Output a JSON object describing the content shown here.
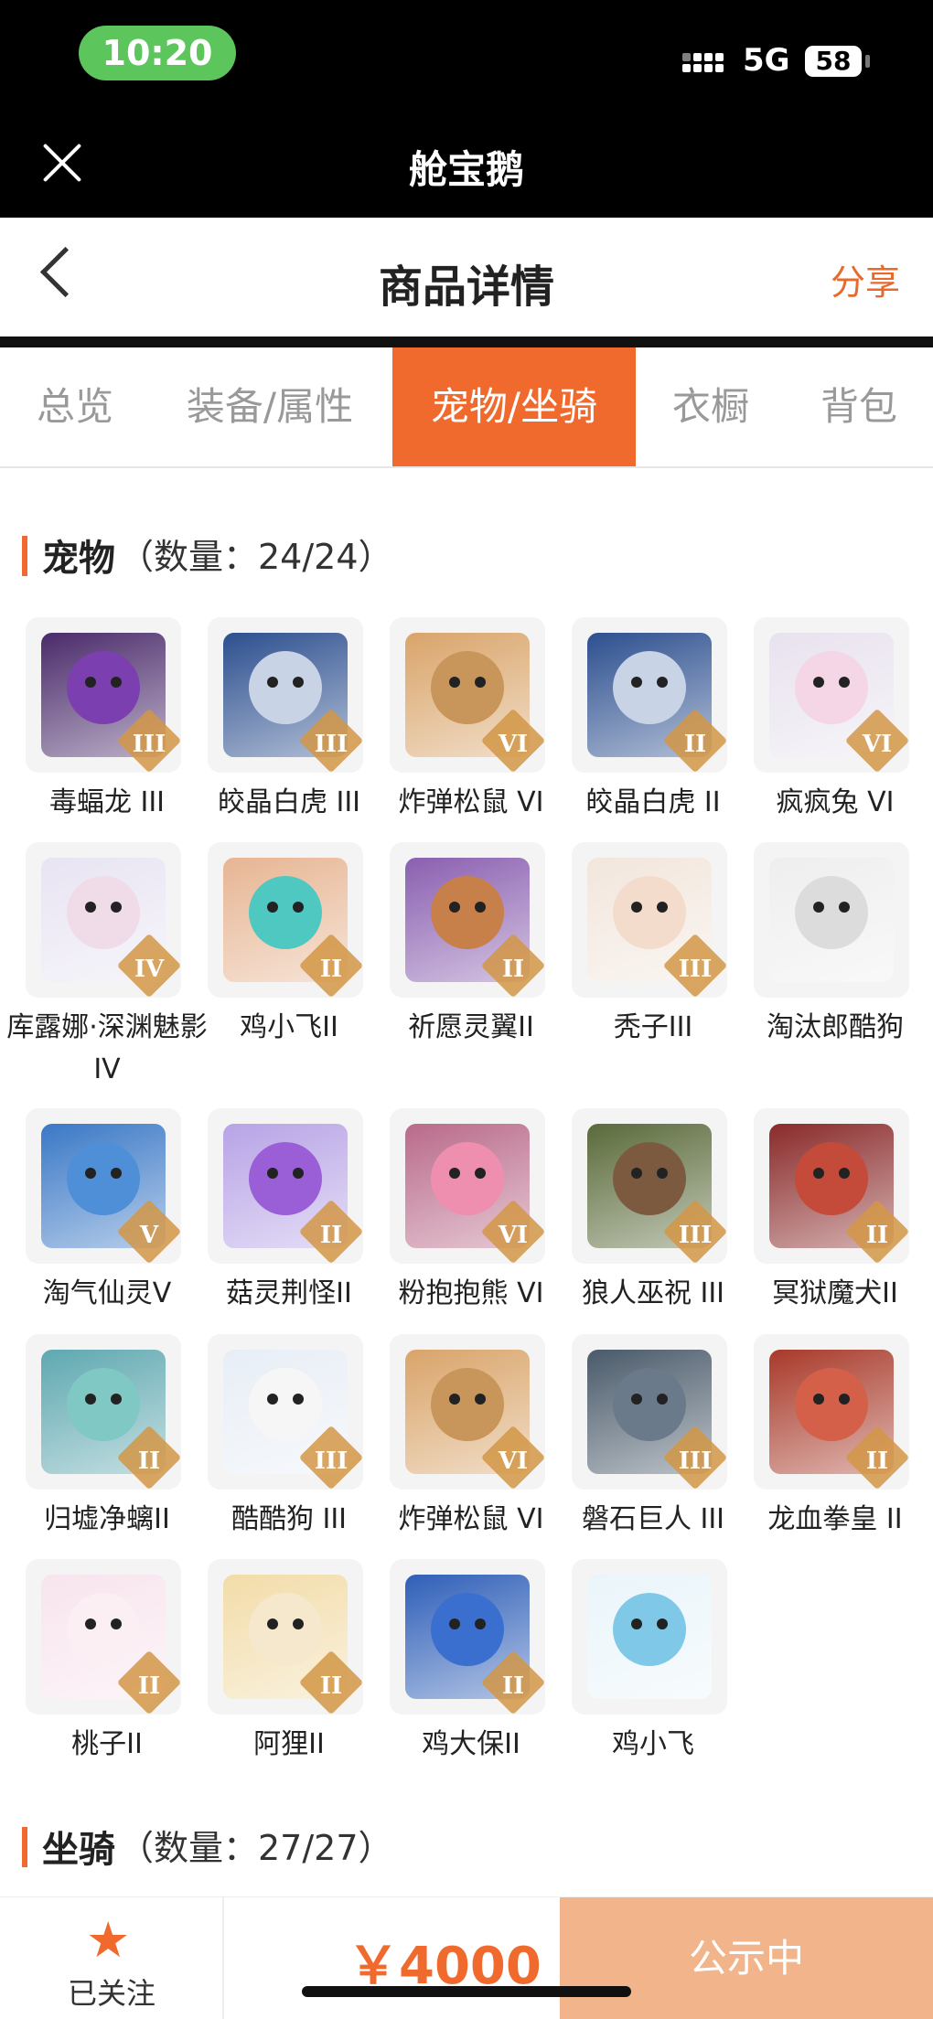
{
  "status_bar": {
    "time": "10:20",
    "network": "5G",
    "battery": "58"
  },
  "app_bar": {
    "title": "舱宝鹅"
  },
  "nav": {
    "title": "商品详情",
    "share": "分享"
  },
  "tabs": [
    {
      "label": "总览",
      "active": false
    },
    {
      "label": "装备/属性",
      "active": false
    },
    {
      "label": "宠物/坐骑",
      "active": true
    },
    {
      "label": "衣橱",
      "active": false
    },
    {
      "label": "背包",
      "active": false
    }
  ],
  "pets_section": {
    "name": "宠物",
    "count": "（数量：24/24）"
  },
  "mounts_section": {
    "name": "坐骑",
    "count": "（数量：27/27）"
  },
  "pets": [
    {
      "name": "毒蝠龙 III",
      "badge": "III",
      "color": "#4a2a6a",
      "head": "#7b3fb0"
    },
    {
      "name": "皎晶白虎 III",
      "badge": "III",
      "color": "#2c4f8f",
      "head": "#c8d4e6"
    },
    {
      "name": "炸弹松鼠 VI",
      "badge": "VI",
      "color": "#d9a46a",
      "head": "#c8955a"
    },
    {
      "name": "皎晶白虎 II",
      "badge": "II",
      "color": "#2c4f8f",
      "head": "#c8d4e6"
    },
    {
      "name": "疯疯兔 VI",
      "badge": "VI",
      "color": "#e8e2ee",
      "head": "#f4d6e6"
    },
    {
      "name": "库露娜·深渊魅影IV",
      "badge": "IV",
      "color": "#e8e4f2",
      "head": "#f0dce8"
    },
    {
      "name": "鸡小飞II",
      "badge": "II",
      "color": "#e7b593",
      "head": "#4ec8c0"
    },
    {
      "name": "祈愿灵翼II",
      "badge": "II",
      "color": "#8a5fb0",
      "head": "#c8804a"
    },
    {
      "name": "秃子III",
      "badge": "III",
      "color": "#f2e6dc",
      "head": "#f3dccb"
    },
    {
      "name": "淘汰郎酷狗",
      "badge": "",
      "color": "#eeeeee",
      "head": "#dcdcdc"
    },
    {
      "name": "淘气仙灵V",
      "badge": "V",
      "color": "#3a78c6",
      "head": "#4f8fd8"
    },
    {
      "name": "菇灵荆怪II",
      "badge": "II",
      "color": "#b7a3e6",
      "head": "#9a5fd6"
    },
    {
      "name": "粉抱抱熊 VI",
      "badge": "VI",
      "color": "#b96a8a",
      "head": "#ee8fb0"
    },
    {
      "name": "狼人巫祝 III",
      "badge": "III",
      "color": "#5a6a3a",
      "head": "#7b5a3f"
    },
    {
      "name": "冥狱魔犬II",
      "badge": "II",
      "color": "#8a2a2a",
      "head": "#c44a3a"
    },
    {
      "name": "归墟净螭II",
      "badge": "II",
      "color": "#5fa8b0",
      "head": "#7fc8c4"
    },
    {
      "name": "酷酷狗 III",
      "badge": "III",
      "color": "#e8eef6",
      "head": "#f6f6f6"
    },
    {
      "name": "炸弹松鼠 VI",
      "badge": "VI",
      "color": "#d9a46a",
      "head": "#c8955a"
    },
    {
      "name": "磐石巨人 III",
      "badge": "III",
      "color": "#4a5a6a",
      "head": "#6a7a8a"
    },
    {
      "name": "龙血拳皇 II",
      "badge": "II",
      "color": "#a83a2a",
      "head": "#d4604a"
    },
    {
      "name": "桃子II",
      "badge": "II",
      "color": "#f8e4ee",
      "head": "#fbeff4"
    },
    {
      "name": "阿狸II",
      "badge": "II",
      "color": "#f2dca8",
      "head": "#f6e8cc"
    },
    {
      "name": "鸡大保II",
      "badge": "II",
      "color": "#2f5fb8",
      "head": "#3a6fd0"
    },
    {
      "name": "鸡小飞",
      "badge": "",
      "color": "#eaf5fa",
      "head": "#7fc8e8"
    }
  ],
  "bottom": {
    "follow": "已关注",
    "price": "￥4000",
    "status": "公示中"
  },
  "accent": "#f06a2e"
}
